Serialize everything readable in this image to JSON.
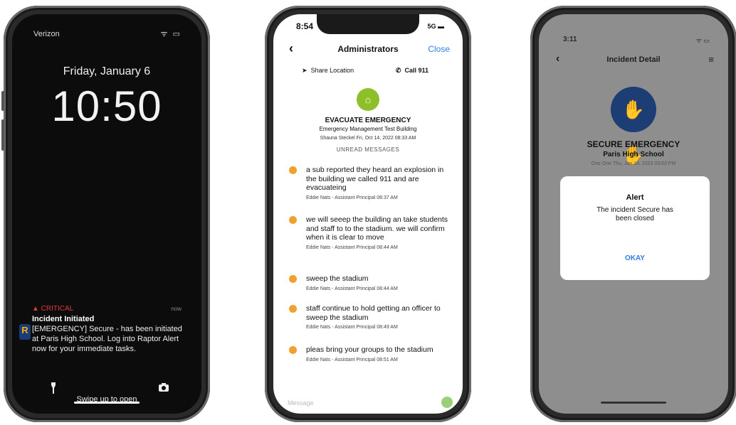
{
  "lock": {
    "carrier": "Verizon",
    "status_icons": "ᯤ ▭",
    "date": "Friday, January 6",
    "time": "10:50",
    "notif_label": "▲ CRITICAL",
    "notif_when": "now",
    "notif_title": "Incident Initiated",
    "notif_body": "[EMERGENCY] Secure - has been initiated at Paris High School. Log into Raptor Alert now for your immediate tasks.",
    "app_icon_letter": "R",
    "swipe": "Swipe up to open",
    "icons": {
      "flashlight": "flashlight-icon",
      "camera": "camera-icon"
    }
  },
  "chat": {
    "time": "8:54",
    "status": "5G ▬",
    "title": "Administrators",
    "close": "Close",
    "share": "Share Location",
    "call": "Call 911",
    "event": "EVACUATE EMERGENCY",
    "building": "Emergency Management Test Building",
    "meta": "Shauna Steckel   Fri, Oct 14, 2022   08:33 AM",
    "unread": "UNREAD MESSAGES",
    "messages": [
      {
        "text": "a sub reported they heard an explosion in the building we called 911 and are evacuateing",
        "from": "Eddie Nats - Assistant Principal  08:37 AM"
      },
      {
        "text": "we will seeep the building an take students and staff to to the stadium. we will confirm when it is clear to move",
        "from": "Eddie Nats - Assistant Principal  08:44 AM"
      },
      {
        "text": "sweep the stadium",
        "from": "Eddie Nats - Assistant Principal  08:44 AM"
      },
      {
        "text": "staff continue to hold getting an officer to sweep the stadium",
        "from": "Eddie Nats - Assistant Principal  08:49 AM"
      },
      {
        "text": "pleas bring your groups to the stadium",
        "from": "Eddie Nats - Assistant Principal  08:51 AM"
      }
    ],
    "placeholder": "Message",
    "accent": "#2f7fe0",
    "emblem_color": "#8dbf2a",
    "dot_color": "#f0a030"
  },
  "incident": {
    "time": "3:11",
    "status": "ᯤ ▭",
    "title": "Incident Detail",
    "event": "SECURE EMERGENCY",
    "school": "Paris High School",
    "meta": "One One   Thu, Jan 19, 2023   03:03 PM",
    "alert_title": "Alert",
    "alert_body": "The incident Secure has been closed",
    "ok": "OKAY",
    "emblem_color": "#1d3d75"
  }
}
